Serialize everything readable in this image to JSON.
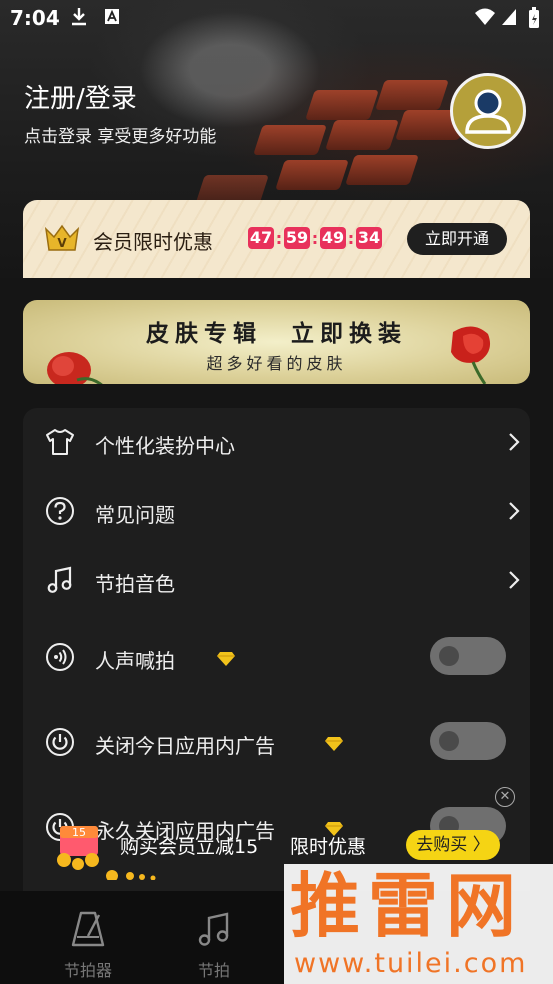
{
  "status_bar": {
    "time": "7:04"
  },
  "header": {
    "login_title": "注册/登录",
    "login_subtitle": "点击登录 享受更多好功能"
  },
  "vip_card": {
    "label": "会员限时优惠",
    "countdown": [
      "47",
      "59",
      "49",
      "34"
    ],
    "separator": ":",
    "open_button": "立即开通",
    "crown_letter": "V"
  },
  "skin_banner": {
    "title": "皮肤专辑　立即换装",
    "subtitle": "超多好看的皮肤"
  },
  "settings": {
    "items": [
      {
        "label": "个性化装扮中心",
        "icon": "tshirt-icon",
        "control": "chevron"
      },
      {
        "label": "常见问题",
        "icon": "question-circle-icon",
        "control": "chevron"
      },
      {
        "label": "节拍音色",
        "icon": "music-note-icon",
        "control": "chevron"
      },
      {
        "label": "人声喊拍",
        "icon": "voice-icon",
        "control": "toggle",
        "premium": true,
        "on": false
      },
      {
        "label": "关闭今日应用内广告",
        "icon": "power-icon",
        "control": "toggle",
        "premium": true,
        "on": false
      },
      {
        "label": "永久关闭应用内广告",
        "icon": "power-icon",
        "control": "toggle",
        "premium": true,
        "on": false
      }
    ]
  },
  "promo": {
    "text": "购买会员立减15",
    "text2": "限时优惠",
    "button": "去购买 〉",
    "badge": "15"
  },
  "bottom_nav": {
    "items": [
      {
        "label": "节拍器",
        "icon": "metronome-icon"
      },
      {
        "label": "节拍",
        "icon": "music-note-icon"
      }
    ]
  },
  "watermark": {
    "big": "推雷网",
    "small": "www.tuilei.com"
  },
  "colors": {
    "accent_red": "#e8315b",
    "gold": "#f5d414",
    "avatar_bg": "#b5a03a",
    "watermark": "#f07426"
  }
}
